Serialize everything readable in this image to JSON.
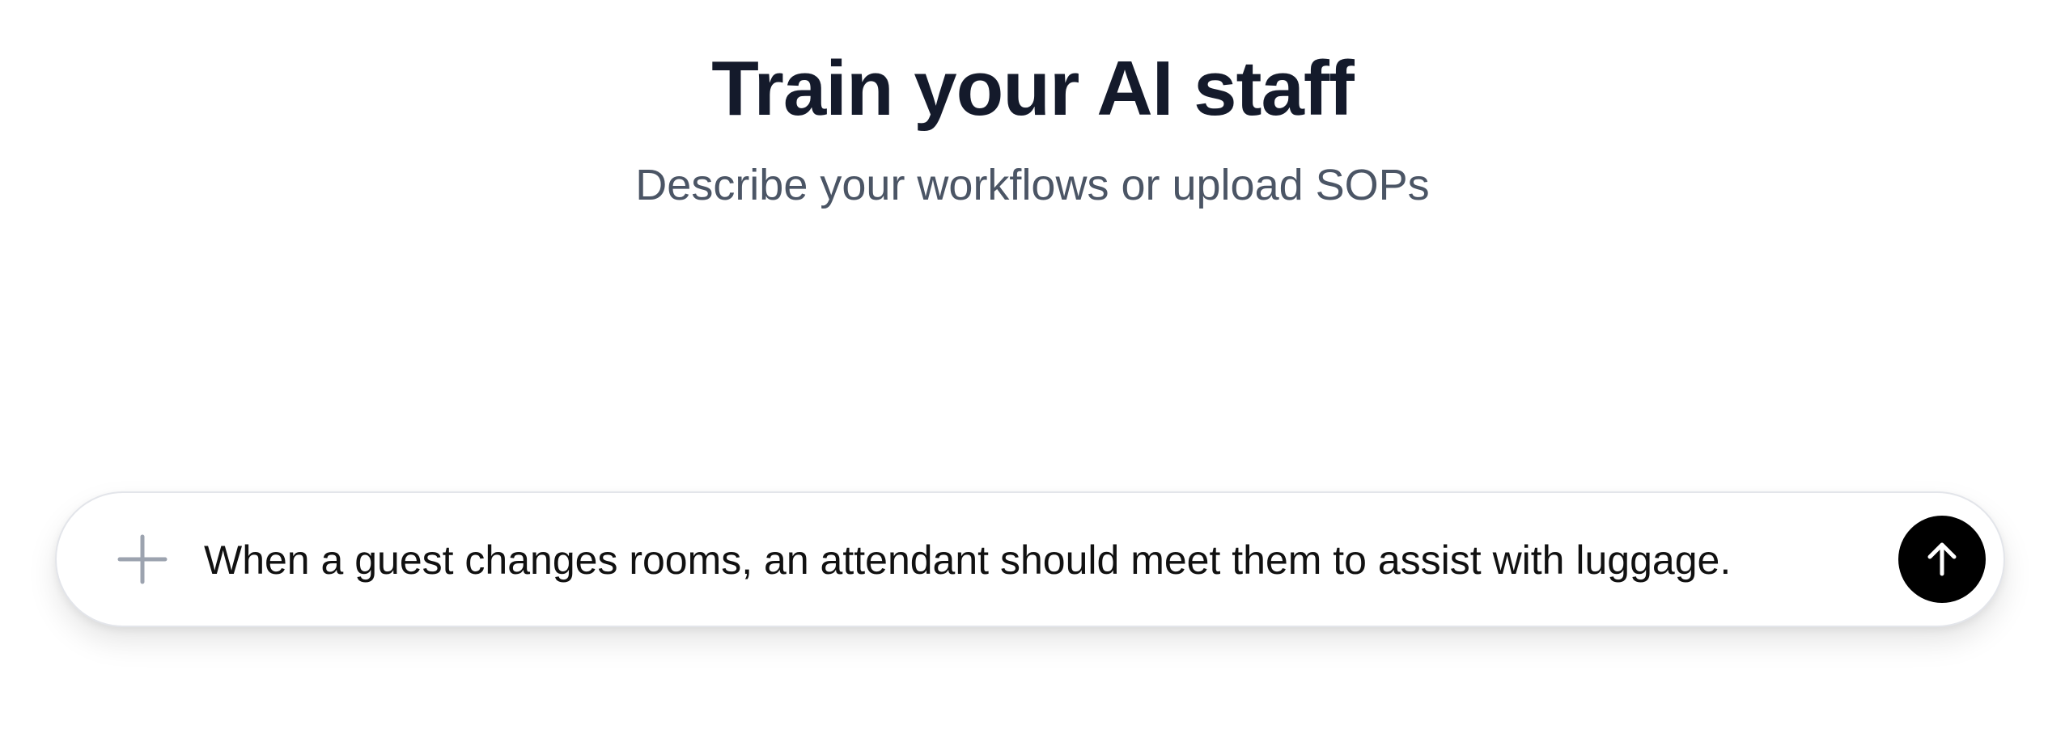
{
  "header": {
    "title": "Train your AI staff",
    "subtitle": "Describe your workflows or upload SOPs"
  },
  "composer": {
    "input_value": "When a guest changes rooms, an attendant should meet them to assist with luggage.",
    "attach_icon": "plus-icon",
    "send_icon": "arrow-up-icon",
    "colors": {
      "title": "#141a2b",
      "subtitle": "#4b5565",
      "send_button_bg": "#000000",
      "attach_icon": "#9ca3af"
    }
  }
}
